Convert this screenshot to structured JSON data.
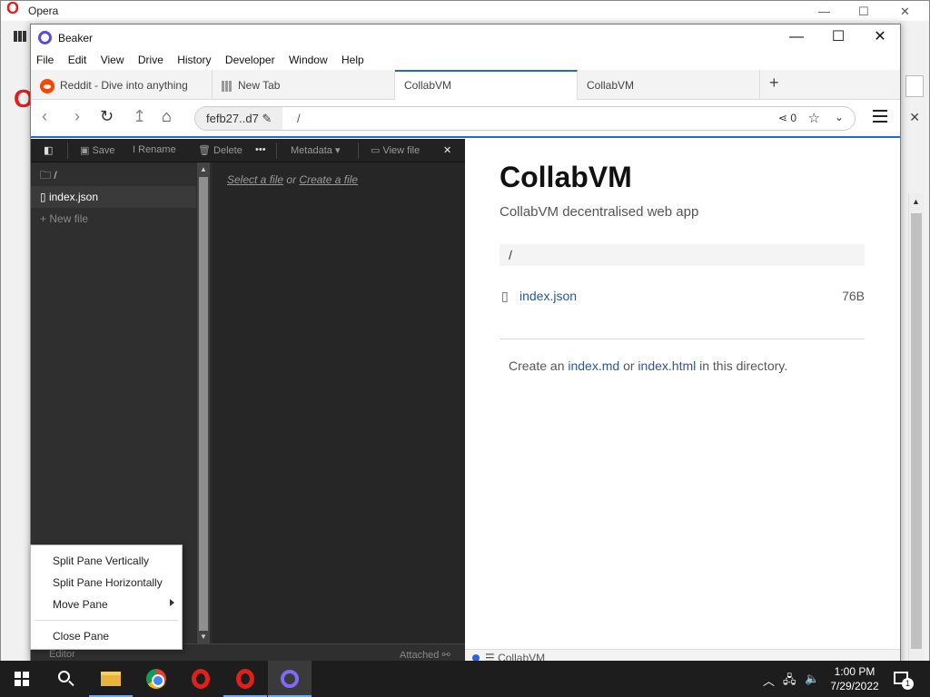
{
  "opera": {
    "title": "Opera",
    "controls": {
      "min": "—",
      "max": "☐",
      "close": "✕"
    }
  },
  "beaker": {
    "title": "Beaker",
    "window_controls": {
      "min": "—",
      "max": "☐",
      "close": "✕"
    },
    "menu": [
      "File",
      "Edit",
      "View",
      "Drive",
      "History",
      "Developer",
      "Window",
      "Help"
    ],
    "tabs": [
      {
        "label": "Reddit - Dive into anything",
        "icon": "reddit-icon"
      },
      {
        "label": "New Tab",
        "icon": "grid-icon"
      },
      {
        "label": "CollabVM",
        "active": true
      },
      {
        "label": "CollabVM"
      }
    ],
    "new_tab": "+",
    "nav": {
      "back": "‹",
      "forward": "›",
      "reload": "↻",
      "up": "↥",
      "home": "⌂",
      "site": "fefb27..d7",
      "edit": "✎",
      "path": "/",
      "share_count": "0",
      "star": "☆",
      "chevron": "⌄"
    }
  },
  "editor": {
    "toolbar": {
      "toggle": "◧",
      "save": "Save",
      "rename": "Rename",
      "delete": "Delete",
      "more": "•••",
      "metadata": "Metadata",
      "view_file": "View file",
      "close": "✕"
    },
    "tree": {
      "root": "/",
      "file": "index.json",
      "new_file": "New file"
    },
    "hint": {
      "select": "Select a file",
      "or": "or",
      "create": "Create a file"
    },
    "status": {
      "editor": "Editor",
      "attached": "Attached ⚯"
    }
  },
  "preview": {
    "title": "CollabVM",
    "description": "CollabVM decentralised web app",
    "crumb": "/",
    "file": {
      "name": "index.json",
      "size": "76B"
    },
    "cta": {
      "prefix": "Create an",
      "md": "index.md",
      "or": "or",
      "html": "index.html",
      "suffix": "in this directory."
    },
    "status": "☰ CollabVM"
  },
  "context_menu": {
    "items": [
      "Split Pane Vertically",
      "Split Pane Horizontally",
      "Move Pane",
      "Close Pane"
    ]
  },
  "taskbar": {
    "time": "1:00 PM",
    "date": "7/29/2022",
    "notifications": "1"
  }
}
